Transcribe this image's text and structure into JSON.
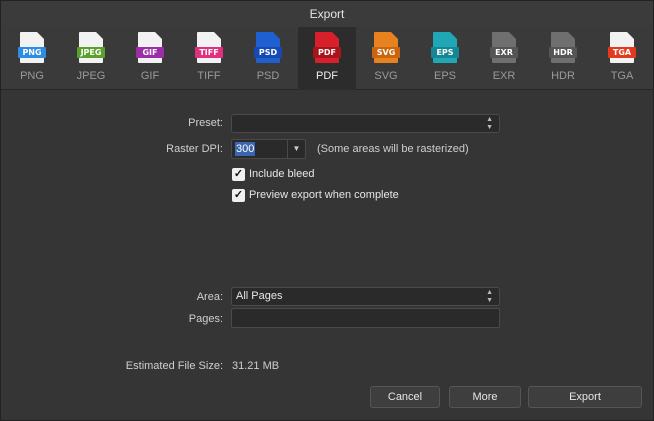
{
  "window": {
    "title": "Export"
  },
  "formats": [
    {
      "name": "PNG",
      "badge": "PNG",
      "color": "#2e8de0"
    },
    {
      "name": "JPEG",
      "badge": "JPEG",
      "color": "#5aa02c"
    },
    {
      "name": "GIF",
      "badge": "GIF",
      "color": "#9c2fa8"
    },
    {
      "name": "TIFF",
      "badge": "TIFF",
      "color": "#e0307f"
    },
    {
      "name": "PSD",
      "badge": "PSD",
      "color": "#1f5fd0"
    },
    {
      "name": "PDF",
      "badge": "PDF",
      "color": "#d8202a"
    },
    {
      "name": "SVG",
      "badge": "SVG",
      "color": "#e8821e"
    },
    {
      "name": "EPS",
      "badge": "EPS",
      "color": "#1fa7b5"
    },
    {
      "name": "EXR",
      "badge": "EXR",
      "color": "#6f6f6f"
    },
    {
      "name": "HDR",
      "badge": "HDR",
      "color": "#6f6f6f"
    },
    {
      "name": "TGA",
      "badge": "TGA",
      "color": "#e23a1e"
    }
  ],
  "selected_format": "PDF",
  "preset": {
    "label": "Preset:",
    "value": ""
  },
  "raster_dpi": {
    "label": "Raster DPI:",
    "value": "300",
    "note": "(Some areas will be rasterized)"
  },
  "include_bleed": {
    "label": "Include bleed",
    "checked": true,
    "mark": "✓"
  },
  "preview_export": {
    "label": "Preview export when complete",
    "checked": true,
    "mark": "✓"
  },
  "area": {
    "label": "Area:",
    "value": "All Pages"
  },
  "pages": {
    "label": "Pages:",
    "value": ""
  },
  "estimated_size": {
    "label": "Estimated File Size:",
    "value": "31.21 MB"
  },
  "buttons": {
    "cancel": "Cancel",
    "more": "More",
    "export": "Export"
  }
}
